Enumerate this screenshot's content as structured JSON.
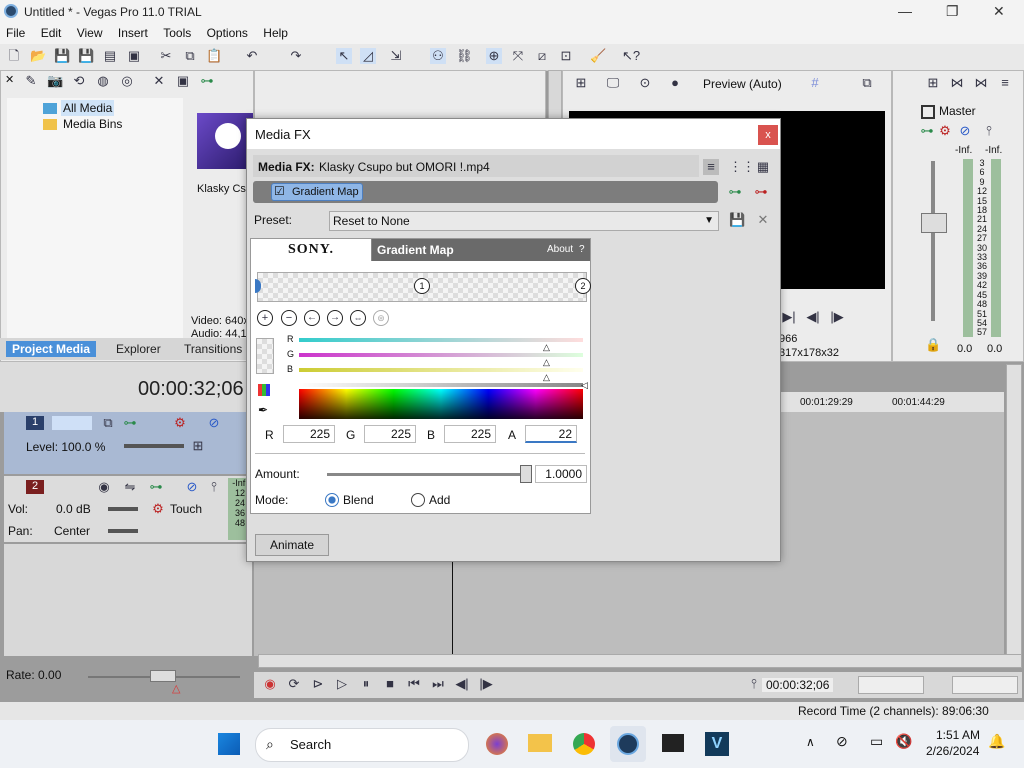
{
  "window": {
    "title": "Untitled * - Vegas Pro 11.0 TRIAL",
    "minimize": "—",
    "maximize": "❐",
    "close": "✕"
  },
  "menu": [
    "File",
    "Edit",
    "View",
    "Insert",
    "Tools",
    "Options",
    "Help"
  ],
  "explorer": {
    "tree": [
      "All Media",
      "Media Bins"
    ],
    "thumb_label": "Klasky Csu",
    "video_info": "Video: 640x",
    "audio_info": "Audio: 44,1",
    "tabs": [
      "Project Media",
      "Explorer",
      "Transitions"
    ]
  },
  "preview": {
    "quality": "Preview (Auto)",
    "frame": "966",
    "size": "317x178x32"
  },
  "master": {
    "label": "Master",
    "left_peak": "-Inf.",
    "right_peak": "-Inf.",
    "scale": [
      "3",
      "6",
      "9",
      "12",
      "15",
      "18",
      "21",
      "24",
      "27",
      "30",
      "33",
      "36",
      "39",
      "42",
      "45",
      "48",
      "51",
      "54",
      "57"
    ],
    "left_level": "0.0",
    "right_level": "0.0"
  },
  "timeline": {
    "timecode": "00:00:32;06",
    "ruler": [
      "00:01:29:29",
      "00:01:44:29"
    ],
    "track1": {
      "number": "1",
      "level": "Level: 100.0 %"
    },
    "track2": {
      "number": "2",
      "vol_label": "Vol:",
      "vol_value": "0.0 dB",
      "pan_label": "Pan:",
      "pan_value": "Center",
      "mode": "Touch",
      "peak": "-Inf.",
      "meter": [
        "12",
        "24",
        "36",
        "48"
      ]
    },
    "rate": "Rate: 0.00",
    "transport_time": "00:00:32;06",
    "record_time": "Record Time (2 channels): 89:06:30"
  },
  "media_fx": {
    "title": "Media FX",
    "close": "x",
    "header_label": "Media FX:",
    "header_file": "Klasky Csupo but OMORI !.mp4",
    "chain_chip": "Gradient Map",
    "preset_label": "Preset:",
    "preset_value": "Reset to None",
    "plugin": {
      "brand": "SONY.",
      "name": "Gradient Map",
      "about": "About",
      "help": "?",
      "stop1": "1",
      "stop2": "2",
      "channels": [
        "R",
        "G",
        "B"
      ],
      "r_label": "R",
      "r_value": "225",
      "g_label": "G",
      "g_value": "225",
      "b_label": "B",
      "b_value": "225",
      "a_label": "A",
      "a_value": "22",
      "amount_label": "Amount:",
      "amount_value": "1.0000",
      "amount_fraction": 1.0,
      "mode_label": "Mode:",
      "mode_blend": "Blend",
      "mode_add": "Add",
      "mode_selected": "Blend"
    },
    "animate_button": "Animate"
  },
  "taskbar": {
    "search": "Search",
    "time": "1:51 AM",
    "date": "2/26/2024"
  },
  "colors": {
    "accent_blue": "#3a78c4",
    "close_red": "#d9534f",
    "chip_blue": "#8fb6e6"
  }
}
